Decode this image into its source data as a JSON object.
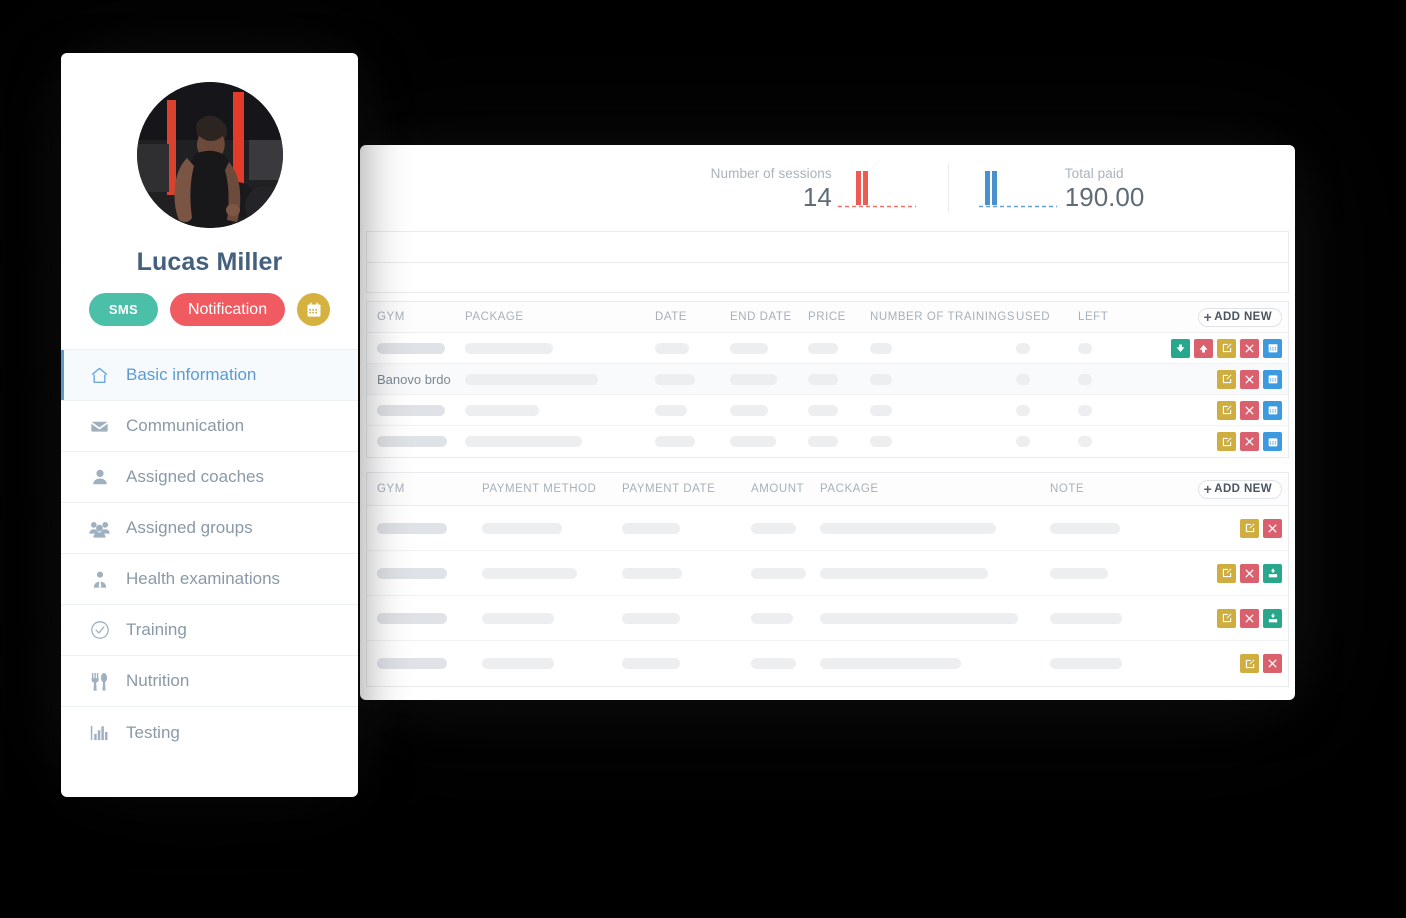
{
  "profile": {
    "name": "Lucas Miller",
    "avatar_alt": "gym-photo-avatar",
    "badges": {
      "sms": "SMS",
      "notification": "Notification",
      "calendar_icon": "calendar-icon"
    }
  },
  "sidebar": {
    "items": [
      {
        "label": "Basic information",
        "icon": "home-icon",
        "active": true
      },
      {
        "label": "Communication",
        "icon": "envelope-icon",
        "active": false
      },
      {
        "label": "Assigned coaches",
        "icon": "user-icon",
        "active": false
      },
      {
        "label": "Assigned groups",
        "icon": "users-icon",
        "active": false
      },
      {
        "label": "Health examinations",
        "icon": "user-md-icon",
        "active": false
      },
      {
        "label": "Training",
        "icon": "check-circle-icon",
        "active": false
      },
      {
        "label": "Nutrition",
        "icon": "cutlery-icon",
        "active": false
      },
      {
        "label": "Testing",
        "icon": "bar-chart-icon",
        "active": false
      }
    ]
  },
  "stats": {
    "sessions": {
      "label": "Number of sessions",
      "value": "14",
      "color": "#ef5b52"
    },
    "paid": {
      "label": "Total paid",
      "value": "190.00",
      "color": "#4a90cf"
    }
  },
  "chart_data": [
    {
      "type": "bar",
      "title": "Number of sessions",
      "categories": [
        "1",
        "2",
        "3",
        "4",
        "5",
        "6",
        "7",
        "8",
        "9",
        "10"
      ],
      "values": [
        0,
        9,
        9,
        0,
        0,
        0,
        0,
        0,
        0,
        0
      ],
      "ylim": [
        0,
        10
      ],
      "color": "#ef5b52",
      "xlabel": "",
      "ylabel": "",
      "grid": false,
      "legend": false
    },
    {
      "type": "bar",
      "title": "Total paid",
      "categories": [
        "1",
        "2",
        "3",
        "4",
        "5",
        "6",
        "7",
        "8",
        "9",
        "10"
      ],
      "values": [
        0,
        9,
        9,
        0,
        0,
        0,
        0,
        0,
        0,
        0
      ],
      "ylim": [
        0,
        10
      ],
      "color": "#4a90cf",
      "xlabel": "",
      "ylabel": "",
      "grid": false,
      "legend": false
    }
  ],
  "packages_table": {
    "add_new_label": "ADD NEW",
    "columns": [
      "GYM",
      "PACKAGE",
      "DATE",
      "END DATE",
      "PRICE",
      "NUMBER OF TRAININGS",
      "USED",
      "LEFT"
    ],
    "rows": [
      {
        "gym": "",
        "loading": true,
        "alt": false,
        "actions": [
          "down-green",
          "up-red",
          "edit-gold",
          "delete-red",
          "calendar-blue"
        ]
      },
      {
        "gym": "Banovo brdo",
        "loading": true,
        "alt": true,
        "actions": [
          "edit-gold",
          "delete-red",
          "calendar-blue"
        ]
      },
      {
        "gym": "",
        "loading": true,
        "alt": false,
        "actions": [
          "edit-gold",
          "delete-red",
          "calendar-blue"
        ]
      },
      {
        "gym": "",
        "loading": true,
        "alt": false,
        "actions": [
          "edit-gold",
          "delete-red",
          "calendar-blue"
        ]
      }
    ]
  },
  "payments_table": {
    "add_new_label": "ADD NEW",
    "columns": [
      "GYM",
      "PAYMENT METHOD",
      "PAYMENT DATE",
      "AMOUNT",
      "PACKAGE",
      "NOTE"
    ],
    "rows": [
      {
        "loading": true,
        "alt": false,
        "actions": [
          "edit-gold",
          "delete-red"
        ]
      },
      {
        "loading": true,
        "alt": false,
        "actions": [
          "edit-gold",
          "delete-red",
          "download-green"
        ]
      },
      {
        "loading": true,
        "alt": false,
        "actions": [
          "edit-gold",
          "delete-red",
          "download-green"
        ]
      },
      {
        "loading": true,
        "alt": false,
        "actions": [
          "edit-gold",
          "delete-red"
        ]
      }
    ]
  },
  "colors": {
    "accent_blue": "#5b9bd5",
    "teal": "#4bbfa8",
    "red": "#ef5b61",
    "gold": "#d5b13f",
    "btn_green": "#28a78c",
    "btn_red": "#d9606c",
    "btn_gold": "#cfae3f",
    "btn_blue": "#3c9ae0",
    "name_text": "#45607e"
  }
}
